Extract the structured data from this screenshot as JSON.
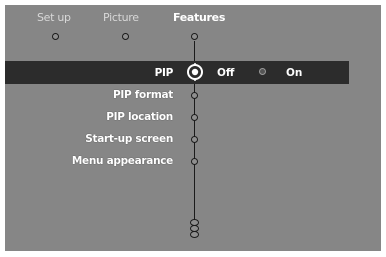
{
  "tabs": [
    {
      "label": "Set up",
      "active": false
    },
    {
      "label": "Picture",
      "active": false
    },
    {
      "label": "Features",
      "active": true
    }
  ],
  "menu": {
    "selected_item": "PIP",
    "items": [
      {
        "label": "PIP"
      },
      {
        "label": "PIP format"
      },
      {
        "label": "PIP location"
      },
      {
        "label": "Start-up screen"
      },
      {
        "label": "Menu appearance"
      }
    ],
    "options": [
      {
        "label": "Off",
        "selected": true
      },
      {
        "label": "On",
        "selected": false
      }
    ]
  },
  "colors": {
    "screen_bg": "#868686",
    "highlight_bar": "#2c2c2c",
    "line": "#1b1b1b",
    "text": "#ffffff"
  },
  "icons": {
    "tab_node": "circle-node-icon",
    "selected_node": "selected-ring-icon",
    "scroll_indicator": "more-items-icon"
  }
}
